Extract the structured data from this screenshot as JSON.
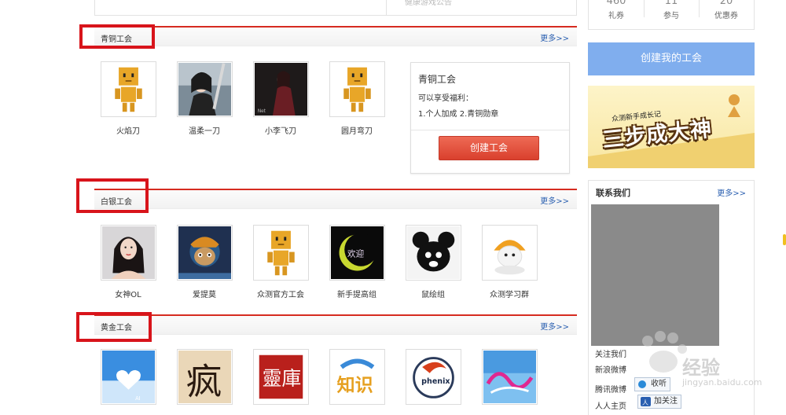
{
  "top_panel": {
    "faint_text": "健康游戏公告"
  },
  "stats": [
    {
      "value": "460",
      "label": "礼券"
    },
    {
      "value": "11",
      "label": "参与"
    },
    {
      "value": "20",
      "label": "优惠券"
    }
  ],
  "create_guild_button": "创建我的工会",
  "banner": {
    "sub": "众测新手成长记",
    "big": "三步成大神"
  },
  "sections": [
    {
      "title": "青铜工会",
      "more": "更多>>",
      "items": [
        {
          "label": "火焰刀",
          "icon": "robot-avatar"
        },
        {
          "label": "温柔一刀",
          "icon": "swordswoman-photo"
        },
        {
          "label": "小李飞刀",
          "icon": "dark-figure-photo"
        },
        {
          "label": "圆月弯刀",
          "icon": "robot-avatar"
        }
      ]
    },
    {
      "title": "白银工会",
      "more": "更多>>",
      "items": [
        {
          "label": "女神OL",
          "icon": "woman-portrait"
        },
        {
          "label": "爱提莫",
          "icon": "teemo-art"
        },
        {
          "label": "众测官方工会",
          "icon": "robot-avatar"
        },
        {
          "label": "新手提高组",
          "icon": "moon-logo"
        },
        {
          "label": "鼠绘组",
          "icon": "mouse-logo"
        },
        {
          "label": "众测学习群",
          "icon": "egg-mascot"
        }
      ]
    },
    {
      "title": "黄金工会",
      "more": "更多>>",
      "items": [
        {
          "label": "",
          "icon": "heart-sky"
        },
        {
          "label": "",
          "icon": "feng-calligraphy"
        },
        {
          "label": "",
          "icon": "red-seal"
        },
        {
          "label": "",
          "icon": "zhishi-logo"
        },
        {
          "label": "",
          "icon": "phenix-logo"
        },
        {
          "label": "",
          "icon": "blue-text-art"
        }
      ]
    }
  ],
  "guild_card": {
    "title": "青铜工会",
    "line1": "可以享受福利：",
    "line2": "1.个人加成 2.青铜勋章",
    "button": "创建工会"
  },
  "contact": {
    "title": "联系我们",
    "more": "更多>>",
    "rows": [
      "关注我们",
      "新浪微博",
      "腾讯微博",
      "人人主页"
    ],
    "listen_btn": "收听",
    "follow_btn": "加关注"
  },
  "watermark": {
    "brand": "经验",
    "url": "jingyan.baidu.com"
  },
  "phenix_text": "phenix",
  "seal_text": "靈庫",
  "zhishi_text": "知识",
  "feng_text": "疯",
  "moon_text": "欢迎"
}
